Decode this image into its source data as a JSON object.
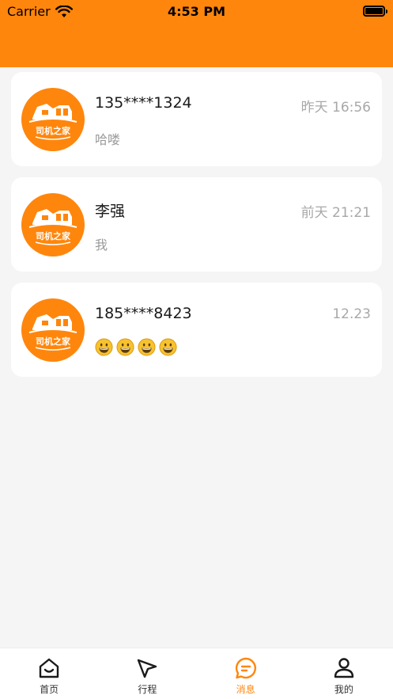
{
  "status_bar": {
    "carrier": "Carrier",
    "time": "4:53 PM"
  },
  "avatar_logo_text": "司机之家",
  "conversations": [
    {
      "name": "135****1324",
      "time": "昨天 16:56",
      "preview": "哈喽"
    },
    {
      "name": "李强",
      "time": "前天 21:21",
      "preview": "我"
    },
    {
      "name": "185****8423",
      "time": "12.23",
      "preview_emoji_count": 4
    }
  ],
  "tabbar": {
    "active": "消息",
    "tabs": [
      {
        "label": "首页",
        "icon": "home-icon"
      },
      {
        "label": "行程",
        "icon": "navigation-arrow-icon"
      },
      {
        "label": "消息",
        "icon": "chat-bubble-icon"
      },
      {
        "label": "我的",
        "icon": "user-icon"
      }
    ]
  },
  "colors": {
    "accent": "#ff860c",
    "background": "#f5f5f5",
    "muted_text": "#a8a8a8"
  }
}
